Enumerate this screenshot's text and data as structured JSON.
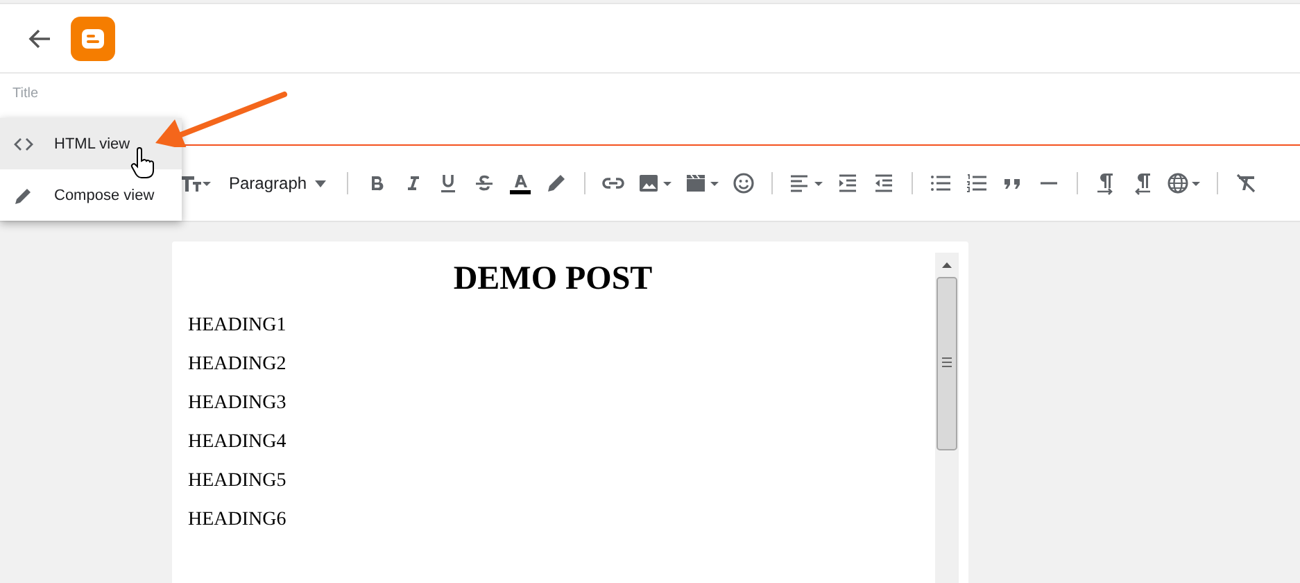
{
  "title_field": {
    "placeholder": "Title"
  },
  "view_menu": [
    {
      "label": "HTML view",
      "selected": true
    },
    {
      "label": "Compose view",
      "selected": false
    }
  ],
  "toolbar": {
    "paragraph_style": "Paragraph"
  },
  "document": {
    "heading": "DEMO POST",
    "paragraphs": [
      "HEADING1",
      "HEADING2",
      "HEADING3",
      "HEADING4",
      "HEADING5",
      "HEADING6"
    ]
  }
}
